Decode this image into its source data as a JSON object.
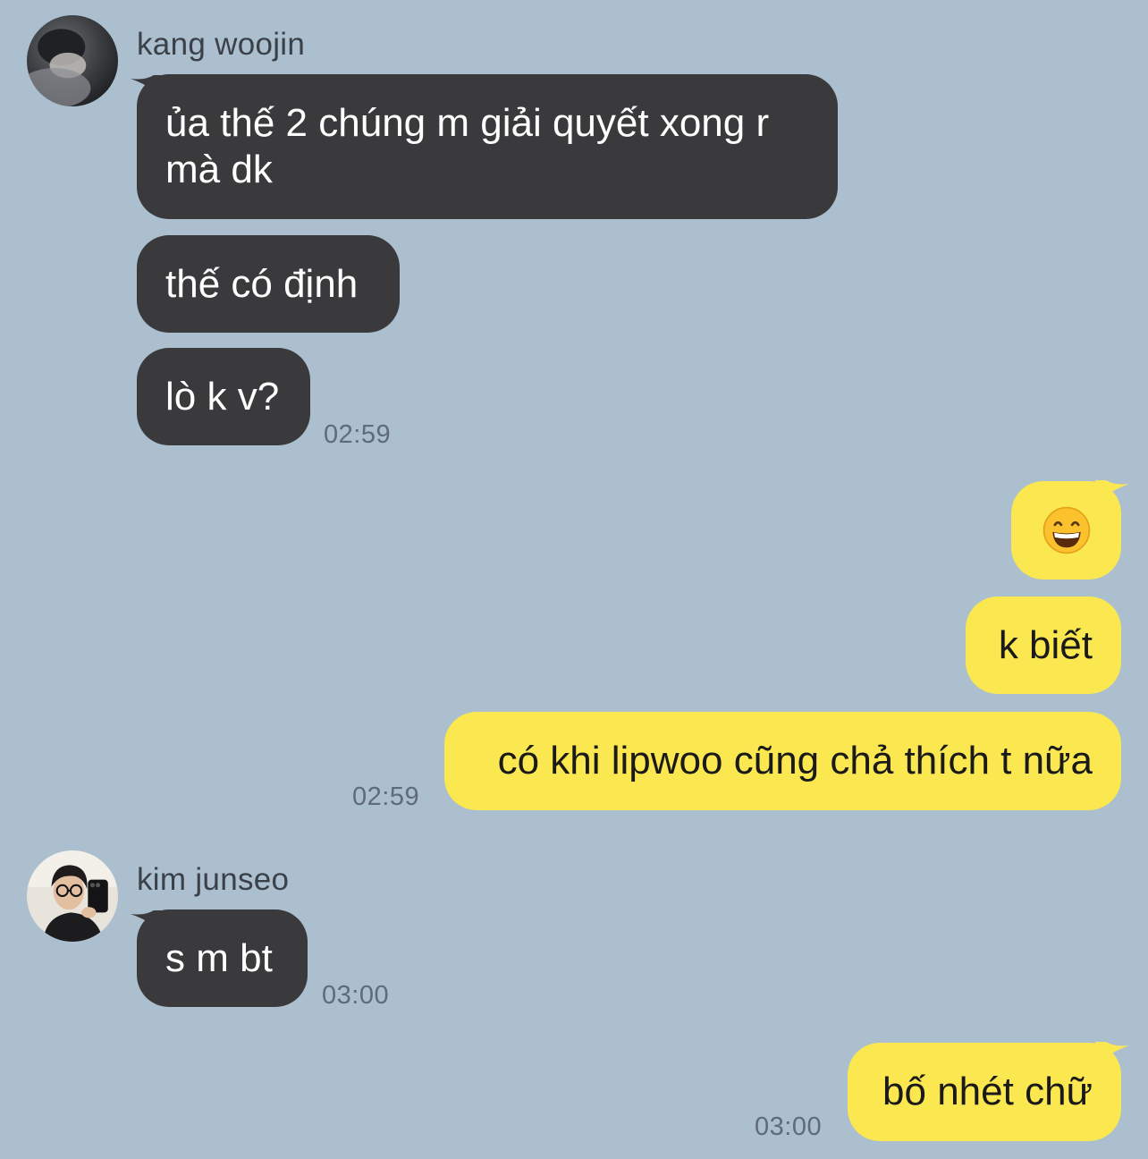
{
  "messages": {
    "woojin": {
      "sender": "kang woojin",
      "bubble1": "ủa thế 2 chúng m giải quyết xong r mà dk",
      "bubble2": "thế có định",
      "bubble3": "lò k v?",
      "time": "02:59"
    },
    "me1": {
      "emoji": "grinning-face-with-smiling-eyes",
      "bubble2": "k biết",
      "bubble3": "có khi lipwoo cũng chả thích t nữa",
      "time": "02:59"
    },
    "junseo": {
      "sender": "kim junseo",
      "bubble1": "s m bt",
      "time": "03:00"
    },
    "me2": {
      "bubble1": "bố nhét chữ",
      "time": "03:00"
    }
  },
  "colors": {
    "background": "#abbfcf",
    "incoming_bubble": "#3a3a3c",
    "outgoing_bubble": "#fbe74f"
  }
}
